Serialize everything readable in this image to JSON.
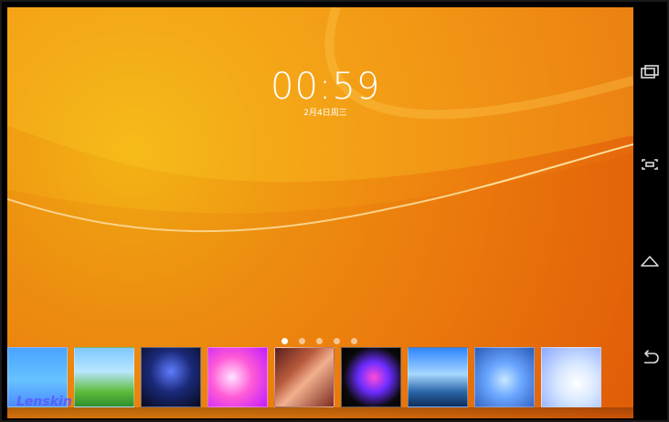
{
  "lockscreen": {
    "time": "00:59",
    "date": "2月4日周三"
  },
  "pager": {
    "dots": 5,
    "active_index": 0
  },
  "wallpapers": [
    {
      "name": "hot-air-balloon-wallpaper",
      "bg": "linear-gradient(180deg,#4aa3ff 0%,#66c2ff 55%,#4b8cff 100%)"
    },
    {
      "name": "rainbow-meadow-wallpaper",
      "bg": "linear-gradient(180deg,#7ec8ff 0%,#b8e6ff 40%,#5dbb3b 75%,#2f8f2c 100%)"
    },
    {
      "name": "starry-galaxy-wallpaper",
      "bg": "radial-gradient(circle at 50% 40%,#5f7bff 0%,#1b2a7a 45%,#070a1d 100%)"
    },
    {
      "name": "pink-bokeh-wallpaper",
      "bg": "radial-gradient(circle at 40% 50%,#ffe2ff 0%,#ff5ad6 45%,#c21cff 100%)"
    },
    {
      "name": "canyon-wallpaper",
      "bg": "linear-gradient(135deg,#5a1f1c 0%,#b85a3c 35%,#f2b08e 55%,#7b2b22 100%)"
    },
    {
      "name": "paint-splash-wallpaper",
      "bg": "radial-gradient(circle at 55% 50%,#ff4bd8 0%,#6b2cff 35%,#0a0a0a 70%,#000 100%)"
    },
    {
      "name": "beach-wallpaper",
      "bg": "linear-gradient(180deg,#2e86ff 0%,#a7d7ff 45%,#2b66a8 75%,#0e2d5a 100%)"
    },
    {
      "name": "abstract-3d-wallpaper",
      "bg": "radial-gradient(circle at 50% 55%,#c6e7ff 0%,#6aa6ff 40%,#2b5ab8 100%)"
    },
    {
      "name": "colorful-shapes-wallpaper",
      "bg": "radial-gradient(circle at 60% 60%,#ffffff 0%,#d7e7ff 40%,#8aa7ff 100%)"
    }
  ],
  "watermark": "Lenskin",
  "navbar": {
    "recent_icon": "recent-apps-icon",
    "screenshot_icon": "screenshot-icon",
    "home_icon": "home-icon",
    "back_icon": "back-icon"
  },
  "colors": {
    "wallpaper_orange": "#ee820f",
    "wallpaper_yellow": "#f3b315"
  }
}
